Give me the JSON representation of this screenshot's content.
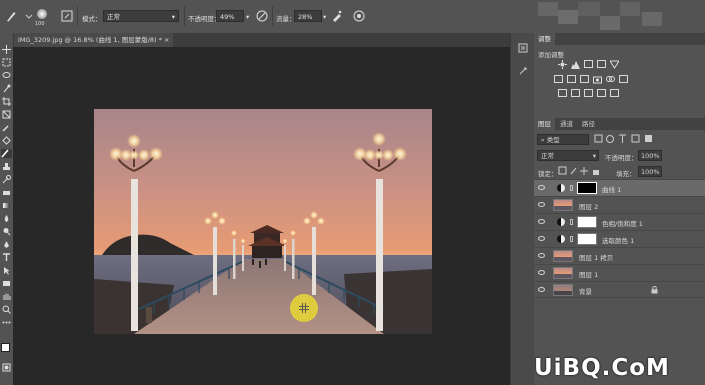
{
  "options_bar": {
    "brush_size": "100",
    "mode_label": "模式：",
    "mode_value": "正常",
    "opacity_label": "不透明度：",
    "opacity_value": "49%",
    "flow_label": "流量：",
    "flow_value": "28%"
  },
  "document_tab": {
    "title": "IMG_3209.jpg @ 16.8% (曲线 1, 图层蒙版/8) * ×"
  },
  "panels": {
    "adjustments_tab": "调整",
    "adjustments_title": "添加调整",
    "layers_tabs": [
      "图层",
      "通道",
      "路径"
    ],
    "kind_filter": "类型",
    "blend_mode": "正常",
    "opacity_label": "不透明度：",
    "opacity_value": "100%",
    "lock_label": "锁定：",
    "fill_label": "填充：",
    "fill_value": "100%",
    "layers": [
      {
        "name": "曲线 1",
        "type": "adjustment",
        "selected": true
      },
      {
        "name": "图层 2",
        "type": "image",
        "selected": false
      },
      {
        "name": "色相/饱和度 1",
        "type": "adjustment",
        "selected": false
      },
      {
        "name": "选取颜色 1",
        "type": "adjustment",
        "selected": false
      },
      {
        "name": "图层 1 拷贝",
        "type": "image",
        "selected": false
      },
      {
        "name": "图层 1",
        "type": "image",
        "selected": false
      },
      {
        "name": "背景",
        "type": "image",
        "selected": false,
        "locked": true
      }
    ]
  },
  "watermark": {
    "text": "UiBQ.CoM"
  },
  "colors": {
    "panel_bg": "#535353",
    "canvas_bg": "#282828",
    "brush_cursor": "#e4d23a",
    "sunset_top": "#b48a86",
    "sunset_low": "#e79b74"
  }
}
